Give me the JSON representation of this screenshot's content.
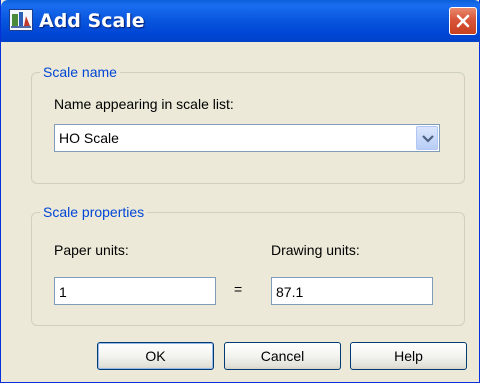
{
  "window": {
    "title": "Add Scale",
    "title_icon": "scale-list-icon",
    "close_icon": "close-icon"
  },
  "scale_name_group": {
    "legend": "Scale name",
    "name_label": "Name appearing in scale list:",
    "name_value": "HO Scale",
    "dropdown_icon": "chevron-down-icon"
  },
  "scale_properties_group": {
    "legend": "Scale properties",
    "paper_units_label": "Paper units:",
    "paper_units_value": "1",
    "equals_sign": "=",
    "drawing_units_label": "Drawing units:",
    "drawing_units_value": "87.1"
  },
  "buttons": {
    "ok": "OK",
    "cancel": "Cancel",
    "help": "Help"
  },
  "colors": {
    "titlebar": "#0055e5",
    "dialog_bg": "#ece9d8",
    "group_legend": "#0046d5",
    "close_button": "#d9553a"
  }
}
